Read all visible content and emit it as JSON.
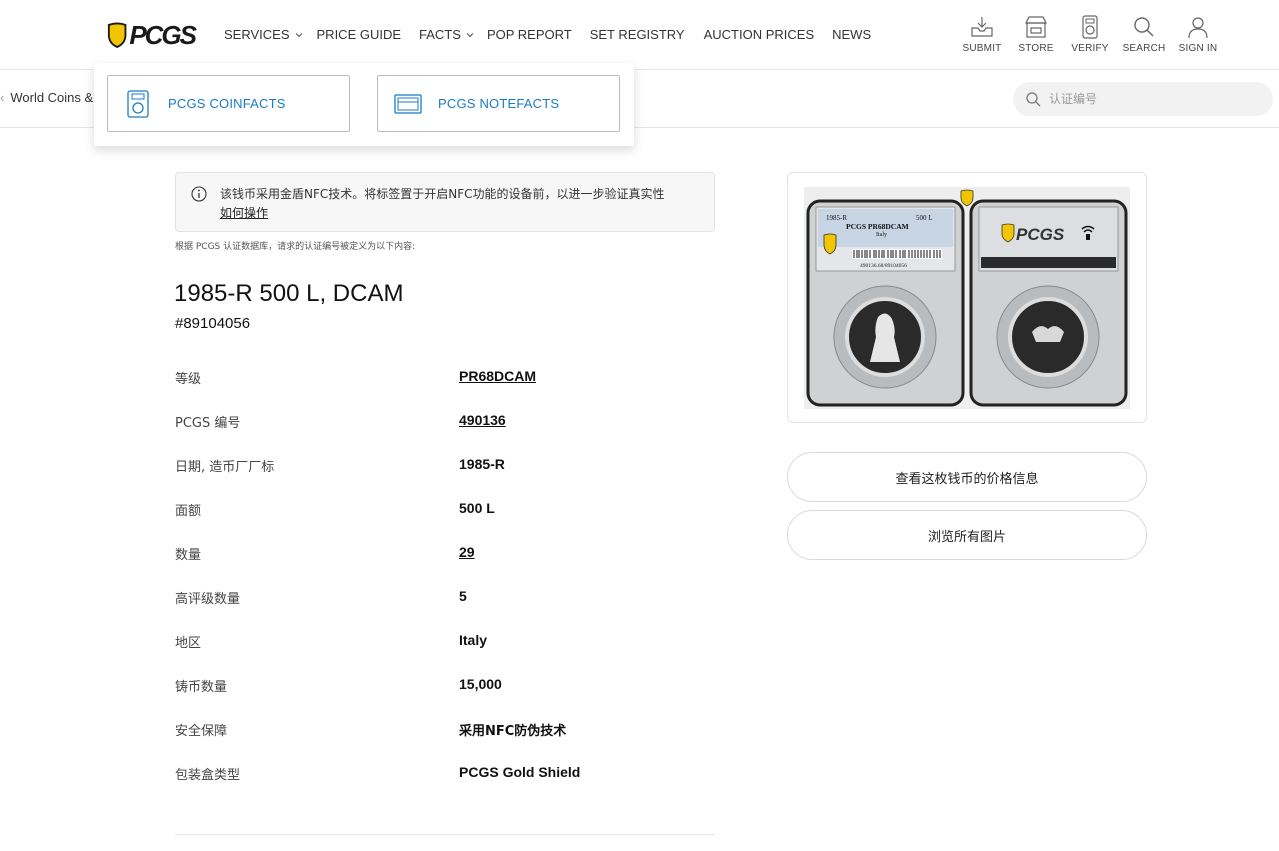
{
  "header": {
    "logo_text": "PCGS",
    "nav": [
      {
        "label": "SERVICES",
        "has_dropdown": true
      },
      {
        "label": "PRICE GUIDE",
        "has_dropdown": false
      },
      {
        "label": "FACTS",
        "has_dropdown": true
      },
      {
        "label": "POP REPORT",
        "has_dropdown": false
      },
      {
        "label": "SET REGISTRY",
        "has_dropdown": false
      },
      {
        "label": "AUCTION PRICES",
        "has_dropdown": false
      },
      {
        "label": "NEWS",
        "has_dropdown": false
      }
    ],
    "actions": [
      {
        "label": "SUBMIT",
        "icon": "submit-tray-icon"
      },
      {
        "label": "STORE",
        "icon": "store-icon"
      },
      {
        "label": "VERIFY",
        "icon": "verify-slab-icon"
      },
      {
        "label": "SEARCH",
        "icon": "search-icon"
      },
      {
        "label": "SIGN IN",
        "icon": "user-icon"
      }
    ]
  },
  "subbar": {
    "breadcrumb": "World Coins &",
    "search_placeholder": "认证编号"
  },
  "dropdown": {
    "items": [
      {
        "label": "PCGS COINFACTS",
        "icon": "coinfacts-icon"
      },
      {
        "label": "PCGS NOTEFACTS",
        "icon": "notefacts-icon"
      }
    ]
  },
  "notice": {
    "text": "该钱币采用金盾NFC技术。将标签置于开启NFC功能的设备前，以进一步验证真实性",
    "link": "如何操作"
  },
  "db_note": "根据 PCGS 认证数据库，请求的认证编号被定义为以下内容:",
  "coin": {
    "title": "1985-R 500 L, DCAM",
    "cert_number": "#89104056"
  },
  "details": [
    {
      "label": "等级",
      "value": "PR68DCAM",
      "link": true
    },
    {
      "label": "PCGS 编号",
      "value": "490136",
      "link": true
    },
    {
      "label": "日期, 造币厂厂标",
      "value": "1985-R",
      "link": false
    },
    {
      "label": "面额",
      "value": "500 L",
      "link": false
    },
    {
      "label": "数量",
      "value": "29",
      "link": true
    },
    {
      "label": "高评级数量",
      "value": "5",
      "link": false
    },
    {
      "label": "地区",
      "value": "Italy",
      "link": false
    },
    {
      "label": "铸币数量",
      "value": "15,000",
      "link": false
    },
    {
      "label": "安全保障",
      "value": "采用NFC防伪技术",
      "link": false
    },
    {
      "label": "包装盒类型",
      "value": "PCGS Gold Shield",
      "link": false
    }
  ],
  "slab_label": {
    "date": "1985-R",
    "denom": "500 L",
    "grade": "PCGS PR68DCAM",
    "country": "Italy",
    "barcode_text": "490136.68/89104056"
  },
  "buttons": {
    "price_info": "查看这枚钱币的价格信息",
    "all_images": "浏览所有图片"
  },
  "colors": {
    "link_blue": "#1a7bc4",
    "shield_gold": "#f2c500"
  }
}
